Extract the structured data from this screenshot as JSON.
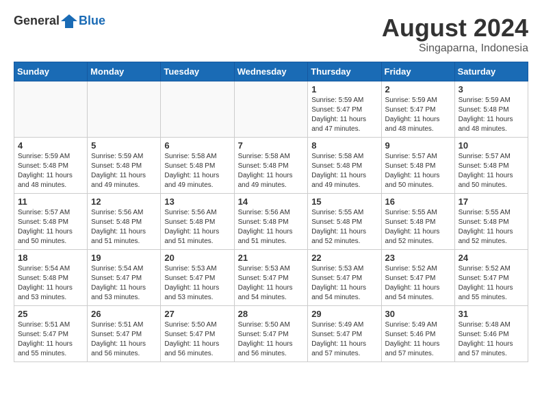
{
  "header": {
    "logo_general": "General",
    "logo_blue": "Blue",
    "month_year": "August 2024",
    "location": "Singaparna, Indonesia"
  },
  "days_of_week": [
    "Sunday",
    "Monday",
    "Tuesday",
    "Wednesday",
    "Thursday",
    "Friday",
    "Saturday"
  ],
  "weeks": [
    [
      {
        "day": "",
        "info": ""
      },
      {
        "day": "",
        "info": ""
      },
      {
        "day": "",
        "info": ""
      },
      {
        "day": "",
        "info": ""
      },
      {
        "day": "1",
        "info": "Sunrise: 5:59 AM\nSunset: 5:47 PM\nDaylight: 11 hours and 47 minutes."
      },
      {
        "day": "2",
        "info": "Sunrise: 5:59 AM\nSunset: 5:47 PM\nDaylight: 11 hours and 48 minutes."
      },
      {
        "day": "3",
        "info": "Sunrise: 5:59 AM\nSunset: 5:48 PM\nDaylight: 11 hours and 48 minutes."
      }
    ],
    [
      {
        "day": "4",
        "info": "Sunrise: 5:59 AM\nSunset: 5:48 PM\nDaylight: 11 hours and 48 minutes."
      },
      {
        "day": "5",
        "info": "Sunrise: 5:59 AM\nSunset: 5:48 PM\nDaylight: 11 hours and 49 minutes."
      },
      {
        "day": "6",
        "info": "Sunrise: 5:58 AM\nSunset: 5:48 PM\nDaylight: 11 hours and 49 minutes."
      },
      {
        "day": "7",
        "info": "Sunrise: 5:58 AM\nSunset: 5:48 PM\nDaylight: 11 hours and 49 minutes."
      },
      {
        "day": "8",
        "info": "Sunrise: 5:58 AM\nSunset: 5:48 PM\nDaylight: 11 hours and 49 minutes."
      },
      {
        "day": "9",
        "info": "Sunrise: 5:57 AM\nSunset: 5:48 PM\nDaylight: 11 hours and 50 minutes."
      },
      {
        "day": "10",
        "info": "Sunrise: 5:57 AM\nSunset: 5:48 PM\nDaylight: 11 hours and 50 minutes."
      }
    ],
    [
      {
        "day": "11",
        "info": "Sunrise: 5:57 AM\nSunset: 5:48 PM\nDaylight: 11 hours and 50 minutes."
      },
      {
        "day": "12",
        "info": "Sunrise: 5:56 AM\nSunset: 5:48 PM\nDaylight: 11 hours and 51 minutes."
      },
      {
        "day": "13",
        "info": "Sunrise: 5:56 AM\nSunset: 5:48 PM\nDaylight: 11 hours and 51 minutes."
      },
      {
        "day": "14",
        "info": "Sunrise: 5:56 AM\nSunset: 5:48 PM\nDaylight: 11 hours and 51 minutes."
      },
      {
        "day": "15",
        "info": "Sunrise: 5:55 AM\nSunset: 5:48 PM\nDaylight: 11 hours and 52 minutes."
      },
      {
        "day": "16",
        "info": "Sunrise: 5:55 AM\nSunset: 5:48 PM\nDaylight: 11 hours and 52 minutes."
      },
      {
        "day": "17",
        "info": "Sunrise: 5:55 AM\nSunset: 5:48 PM\nDaylight: 11 hours and 52 minutes."
      }
    ],
    [
      {
        "day": "18",
        "info": "Sunrise: 5:54 AM\nSunset: 5:48 PM\nDaylight: 11 hours and 53 minutes."
      },
      {
        "day": "19",
        "info": "Sunrise: 5:54 AM\nSunset: 5:47 PM\nDaylight: 11 hours and 53 minutes."
      },
      {
        "day": "20",
        "info": "Sunrise: 5:53 AM\nSunset: 5:47 PM\nDaylight: 11 hours and 53 minutes."
      },
      {
        "day": "21",
        "info": "Sunrise: 5:53 AM\nSunset: 5:47 PM\nDaylight: 11 hours and 54 minutes."
      },
      {
        "day": "22",
        "info": "Sunrise: 5:53 AM\nSunset: 5:47 PM\nDaylight: 11 hours and 54 minutes."
      },
      {
        "day": "23",
        "info": "Sunrise: 5:52 AM\nSunset: 5:47 PM\nDaylight: 11 hours and 54 minutes."
      },
      {
        "day": "24",
        "info": "Sunrise: 5:52 AM\nSunset: 5:47 PM\nDaylight: 11 hours and 55 minutes."
      }
    ],
    [
      {
        "day": "25",
        "info": "Sunrise: 5:51 AM\nSunset: 5:47 PM\nDaylight: 11 hours and 55 minutes."
      },
      {
        "day": "26",
        "info": "Sunrise: 5:51 AM\nSunset: 5:47 PM\nDaylight: 11 hours and 56 minutes."
      },
      {
        "day": "27",
        "info": "Sunrise: 5:50 AM\nSunset: 5:47 PM\nDaylight: 11 hours and 56 minutes."
      },
      {
        "day": "28",
        "info": "Sunrise: 5:50 AM\nSunset: 5:47 PM\nDaylight: 11 hours and 56 minutes."
      },
      {
        "day": "29",
        "info": "Sunrise: 5:49 AM\nSunset: 5:47 PM\nDaylight: 11 hours and 57 minutes."
      },
      {
        "day": "30",
        "info": "Sunrise: 5:49 AM\nSunset: 5:46 PM\nDaylight: 11 hours and 57 minutes."
      },
      {
        "day": "31",
        "info": "Sunrise: 5:48 AM\nSunset: 5:46 PM\nDaylight: 11 hours and 57 minutes."
      }
    ]
  ]
}
